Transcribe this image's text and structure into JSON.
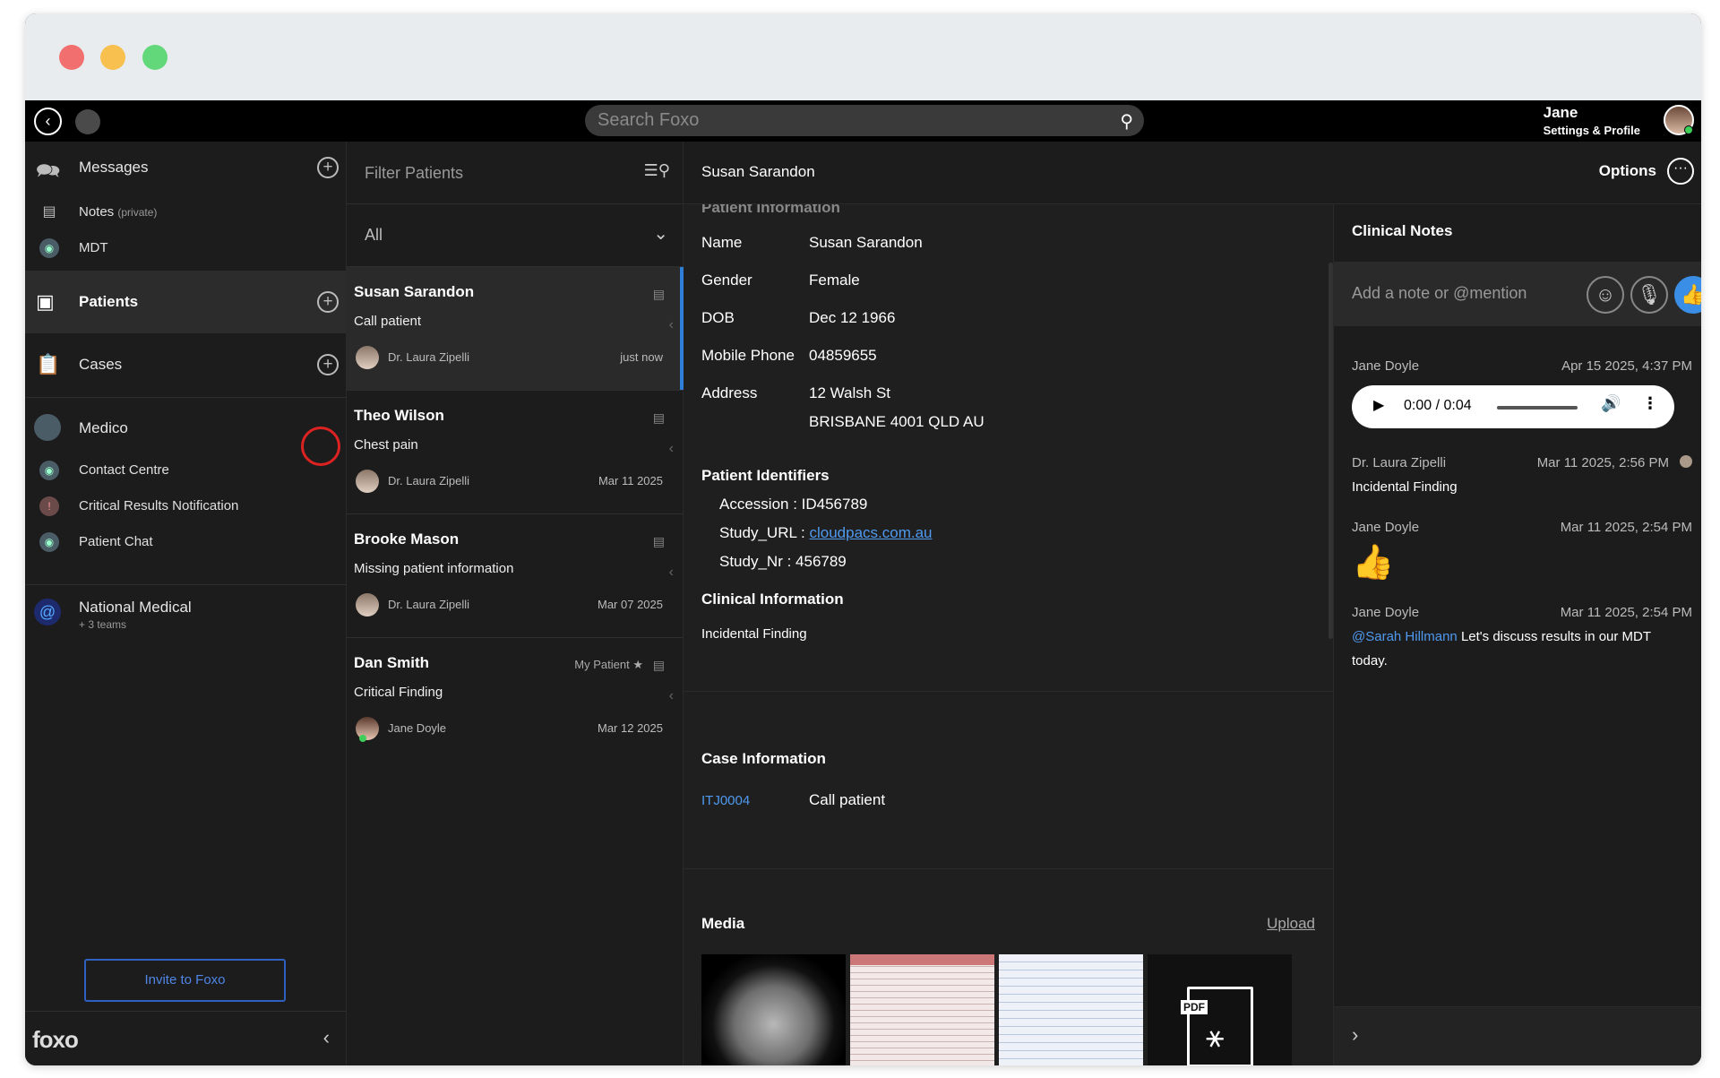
{
  "topbar": {
    "search_placeholder": "Search Foxo",
    "user_name": "Jane",
    "user_sub": "Settings & Profile"
  },
  "sidebar": {
    "messages": "Messages",
    "notes": "Notes",
    "notes_tag": "(private)",
    "mdt": "MDT",
    "patients": "Patients",
    "cases": "Cases",
    "medico": "Medico",
    "contact_centre": "Contact Centre",
    "critical_results": "Critical Results Notification",
    "patient_chat": "Patient Chat",
    "national_medical": "National Medical",
    "teams": "+ 3 teams",
    "invite": "Invite to Foxo",
    "logo": "foxo"
  },
  "patient_list": {
    "filter_placeholder": "Filter Patients",
    "filter_value": "All",
    "patients": [
      {
        "name": "Susan Sarandon",
        "reason": "Call patient",
        "doctor": "Dr. Laura Zipelli",
        "when": "just now",
        "tag": ""
      },
      {
        "name": "Theo Wilson",
        "reason": "Chest pain",
        "doctor": "Dr. Laura Zipelli",
        "when": "Mar 11 2025",
        "tag": ""
      },
      {
        "name": "Brooke Mason",
        "reason": "Missing patient information",
        "doctor": "Dr. Laura Zipelli",
        "when": "Mar 07 2025",
        "tag": ""
      },
      {
        "name": "Dan Smith",
        "reason": "Critical Finding",
        "doctor": "Jane Doyle",
        "when": "Mar 12 2025",
        "tag": "My Patient"
      }
    ]
  },
  "detail": {
    "header": "Susan Sarandon",
    "options": "Options",
    "section_cut": "Patient Information",
    "name_label": "Name",
    "name": "Susan Sarandon",
    "gender_label": "Gender",
    "gender": "Female",
    "dob_label": "DOB",
    "dob": "Dec 12 1966",
    "phone_label": "Mobile Phone",
    "phone": "04859655",
    "address_label": "Address",
    "address1": "12 Walsh St",
    "address2": "BRISBANE 4001 QLD AU",
    "identifiers_title": "Patient Identifiers",
    "accession": "Accession : ID456789",
    "study_url_label": "Study_URL :",
    "study_url": "cloudpacs.com.au",
    "study_nr": "Study_Nr : 456789",
    "clinical_title": "Clinical Information",
    "clinical_text": "Incidental Finding",
    "case_title": "Case Information",
    "case_id": "ITJ0004",
    "case_desc": "Call patient",
    "media_title": "Media",
    "upload": "Upload",
    "pdf_tag": "PDF"
  },
  "notes": {
    "title": "Clinical Notes",
    "placeholder": "Add a note or @mention",
    "items": [
      {
        "who": "Jane Doyle",
        "date": "Apr 15 2025, 4:37 PM",
        "audio_time": "0:00 / 0:04"
      },
      {
        "who": "Dr. Laura Zipelli",
        "date": "Mar 11 2025, 2:56 PM",
        "text": "Incidental Finding"
      },
      {
        "who": "Jane Doyle",
        "date": "Mar 11 2025, 2:54 PM"
      },
      {
        "who": "Jane Doyle",
        "date": "Mar 11 2025, 2:54 PM",
        "mention": "@Sarah Hillmann",
        "text": " Let's discuss results in our MDT today."
      }
    ]
  },
  "colors": {
    "accent": "#2f7fd8",
    "link": "#4f9af0",
    "highlight_ring": "#dd2222"
  }
}
